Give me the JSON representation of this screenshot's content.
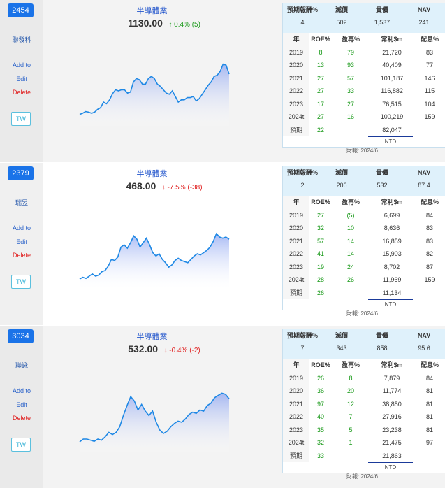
{
  "labels": {
    "add": "Add to",
    "edit": "Edit",
    "delete": "Delete",
    "tw": "TW",
    "col_return": "預期報酬%",
    "col_cheap": "滅價",
    "col_expensive": "貴價",
    "col_nav": "NAV",
    "t_year": "年",
    "t_roe": "ROE%",
    "t_margin": "盈再%",
    "t_profit": "常利$m",
    "t_div": "配息%",
    "currency": "NTD",
    "up_arrow": "↑",
    "down_arrow": "↓"
  },
  "stocks": [
    {
      "ticker": "2454",
      "name": "聯發科",
      "industry": "半導體業",
      "price": "1130.00",
      "change": "0.4% (5)",
      "direction": "up",
      "summary": {
        "return": "4",
        "cheap": "502",
        "expensive": "1,537",
        "nav": "241"
      },
      "rows": [
        {
          "year": "2019",
          "roe": "8",
          "margin": "79",
          "profit": "21,720",
          "div": "83"
        },
        {
          "year": "2020",
          "roe": "13",
          "margin": "93",
          "profit": "40,409",
          "div": "77"
        },
        {
          "year": "2021",
          "roe": "27",
          "margin": "57",
          "profit": "101,187",
          "div": "146"
        },
        {
          "year": "2022",
          "roe": "27",
          "margin": "33",
          "profit": "116,882",
          "div": "115"
        },
        {
          "year": "2023",
          "roe": "17",
          "margin": "27",
          "profit": "76,515",
          "div": "104"
        },
        {
          "year": "2024t",
          "roe": "27",
          "margin": "16",
          "profit": "100,219",
          "div": "159"
        }
      ],
      "forecast": {
        "label": "預期",
        "roe": "22",
        "profit": "82,047"
      },
      "report": "財報: 2024/6",
      "spark": [
        0.08,
        0.1,
        0.13,
        0.12,
        0.1,
        0.12,
        0.17,
        0.2,
        0.3,
        0.27,
        0.34,
        0.45,
        0.52,
        0.5,
        0.52,
        0.52,
        0.46,
        0.48,
        0.66,
        0.72,
        0.7,
        0.62,
        0.62,
        0.72,
        0.76,
        0.72,
        0.62,
        0.58,
        0.52,
        0.46,
        0.44,
        0.5,
        0.4,
        0.3,
        0.34,
        0.34,
        0.38,
        0.38,
        0.4,
        0.32,
        0.36,
        0.44,
        0.52,
        0.6,
        0.66,
        0.76,
        0.78,
        0.85,
        0.98,
        0.96,
        0.8
      ]
    },
    {
      "ticker": "2379",
      "name": "瑞昱",
      "industry": "半導體業",
      "price": "468.00",
      "change": "-7.5% (-38)",
      "direction": "down",
      "summary": {
        "return": "2",
        "cheap": "206",
        "expensive": "532",
        "nav": "87.4"
      },
      "rows": [
        {
          "year": "2019",
          "roe": "27",
          "margin": "(5)",
          "profit": "6,699",
          "div": "84"
        },
        {
          "year": "2020",
          "roe": "32",
          "margin": "10",
          "profit": "8,636",
          "div": "83"
        },
        {
          "year": "2021",
          "roe": "57",
          "margin": "14",
          "profit": "16,859",
          "div": "83"
        },
        {
          "year": "2022",
          "roe": "41",
          "margin": "14",
          "profit": "15,903",
          "div": "82"
        },
        {
          "year": "2023",
          "roe": "19",
          "margin": "24",
          "profit": "8,702",
          "div": "87"
        },
        {
          "year": "2024t",
          "roe": "28",
          "margin": "26",
          "profit": "11,969",
          "div": "159"
        }
      ],
      "forecast": {
        "label": "預期",
        "roe": "26",
        "profit": "11,134"
      },
      "report": "財報: 2024/6",
      "spark": [
        0.05,
        0.08,
        0.06,
        0.1,
        0.14,
        0.1,
        0.12,
        0.18,
        0.2,
        0.28,
        0.4,
        0.38,
        0.44,
        0.62,
        0.66,
        0.6,
        0.7,
        0.82,
        0.76,
        0.62,
        0.7,
        0.78,
        0.66,
        0.52,
        0.46,
        0.5,
        0.4,
        0.34,
        0.26,
        0.3,
        0.38,
        0.42,
        0.38,
        0.36,
        0.34,
        0.4,
        0.46,
        0.5,
        0.48,
        0.52,
        0.56,
        0.62,
        0.72,
        0.86,
        0.8,
        0.78,
        0.8,
        0.76
      ]
    },
    {
      "ticker": "3034",
      "name": "聯詠",
      "industry": "半導體業",
      "price": "532.00",
      "change": "-0.4% (-2)",
      "direction": "down",
      "summary": {
        "return": "7",
        "cheap": "343",
        "expensive": "858",
        "nav": "95.6"
      },
      "rows": [
        {
          "year": "2019",
          "roe": "26",
          "margin": "8",
          "profit": "7,879",
          "div": "84"
        },
        {
          "year": "2020",
          "roe": "36",
          "margin": "20",
          "profit": "11,774",
          "div": "81"
        },
        {
          "year": "2021",
          "roe": "97",
          "margin": "12",
          "profit": "38,850",
          "div": "81"
        },
        {
          "year": "2022",
          "roe": "40",
          "margin": "7",
          "profit": "27,916",
          "div": "81"
        },
        {
          "year": "2023",
          "roe": "35",
          "margin": "5",
          "profit": "23,238",
          "div": "81"
        },
        {
          "year": "2024t",
          "roe": "32",
          "margin": "1",
          "profit": "21,475",
          "div": "97"
        }
      ],
      "forecast": {
        "label": "預期",
        "roe": "33",
        "profit": "21,863"
      },
      "report": "財報: 2024/6",
      "spark": [
        0.05,
        0.1,
        0.1,
        0.08,
        0.06,
        0.1,
        0.08,
        0.14,
        0.22,
        0.18,
        0.22,
        0.32,
        0.52,
        0.7,
        0.86,
        0.78,
        0.62,
        0.72,
        0.6,
        0.52,
        0.6,
        0.4,
        0.26,
        0.2,
        0.24,
        0.32,
        0.38,
        0.42,
        0.4,
        0.46,
        0.54,
        0.58,
        0.56,
        0.62,
        0.6,
        0.7,
        0.74,
        0.84,
        0.88,
        0.92,
        0.9,
        0.82
      ]
    }
  ]
}
